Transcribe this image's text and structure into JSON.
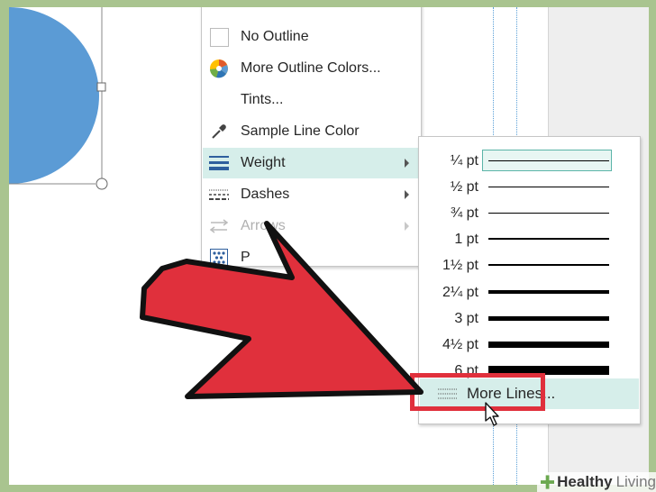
{
  "menu": {
    "items": [
      {
        "label": "No Outline",
        "icon": "no-outline-icon"
      },
      {
        "label": "More Outline Colors...",
        "icon": "color-wheel-icon"
      },
      {
        "label": "Tints...",
        "icon": ""
      },
      {
        "label": "Sample Line Color",
        "icon": "eyedropper-icon"
      },
      {
        "label": "Weight",
        "icon": "line-weight-icon",
        "submenu": true,
        "highlighted": true
      },
      {
        "label": "Dashes",
        "icon": "dashes-icon",
        "submenu": true
      },
      {
        "label": "Arrows",
        "icon": "arrows-icon",
        "submenu": true,
        "disabled": true
      },
      {
        "label": "P",
        "icon": "pattern-icon"
      }
    ],
    "swatch_colors": [
      "#c00000",
      "#ff0000",
      "#ffc000",
      "#ffff00",
      "#92d050",
      "#00b050",
      "#00b0f0",
      "#0070c0",
      "#002060",
      "#7030a0"
    ]
  },
  "weight_submenu": {
    "options": [
      {
        "label": "¼ pt",
        "weight_pt": 0.25,
        "selected": true
      },
      {
        "label": "½ pt",
        "weight_pt": 0.5
      },
      {
        "label": "¾ pt",
        "weight_pt": 0.75
      },
      {
        "label": "1 pt",
        "weight_pt": 1
      },
      {
        "label": "1½ pt",
        "weight_pt": 1.5
      },
      {
        "label": "2¼ pt",
        "weight_pt": 2.25
      },
      {
        "label": "3 pt",
        "weight_pt": 3
      },
      {
        "label": "4½ pt",
        "weight_pt": 4.5
      },
      {
        "label": "6 pt",
        "weight_pt": 6
      }
    ],
    "more_lines_label": "More Lines..."
  },
  "colors": {
    "shape_fill": "#5b9bd5",
    "highlight": "#d6eeea",
    "callout_arrow": "#e0303c",
    "callout_box": "#e0303c",
    "background": "#a9c48f"
  },
  "watermark": {
    "brand": "Healthy",
    "suffix": "Living"
  }
}
